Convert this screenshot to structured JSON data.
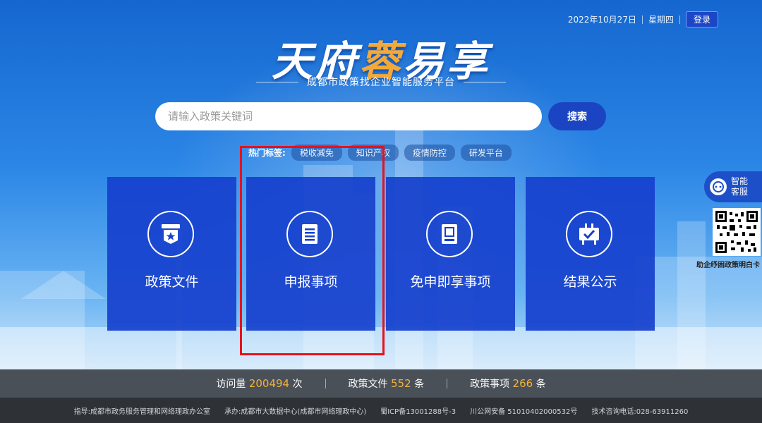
{
  "header": {
    "date": "2022年10月27日",
    "weekday": "星期四",
    "login_label": "登录"
  },
  "logo": {
    "part1": "天府",
    "part2": "蓉",
    "part3": "易享",
    "subtitle": "成都市政策找企业智能服务平台"
  },
  "search": {
    "placeholder": "请输入政策关键词",
    "button_label": "搜索"
  },
  "hot_tags": {
    "label": "热门标签:",
    "tags": [
      "税收减免",
      "知识产权",
      "疫情防控",
      "研发平台"
    ]
  },
  "cards": [
    {
      "label": "政策文件",
      "icon": "policy-badge-icon"
    },
    {
      "label": "申报事项",
      "icon": "document-list-icon"
    },
    {
      "label": "免申即享事项",
      "icon": "inbox-tray-icon"
    },
    {
      "label": "结果公示",
      "icon": "notice-board-icon"
    }
  ],
  "side": {
    "service_label": "智能客服",
    "qr_caption": "助企纾困政策明白卡"
  },
  "stats": [
    {
      "label": "访问量",
      "value": "200494",
      "unit": "次"
    },
    {
      "label": "政策文件",
      "value": "552",
      "unit": "条"
    },
    {
      "label": "政策事项",
      "value": "266",
      "unit": "条"
    }
  ],
  "footer": {
    "guide": "指导:成都市政务服务管理和网络理政办公室",
    "undertake": "承办:成都市大数据中心(成都市网络理政中心)",
    "icp": "蜀ICP备13001288号-3",
    "police": "川公网安备 51010402000532号",
    "phone": "技术咨询电话:028-63911260"
  },
  "colors": {
    "card_bg": "#1640cd",
    "accent_orange": "#f3a93a",
    "highlight_box": "#e8101b",
    "button_blue": "#1b44c2"
  }
}
